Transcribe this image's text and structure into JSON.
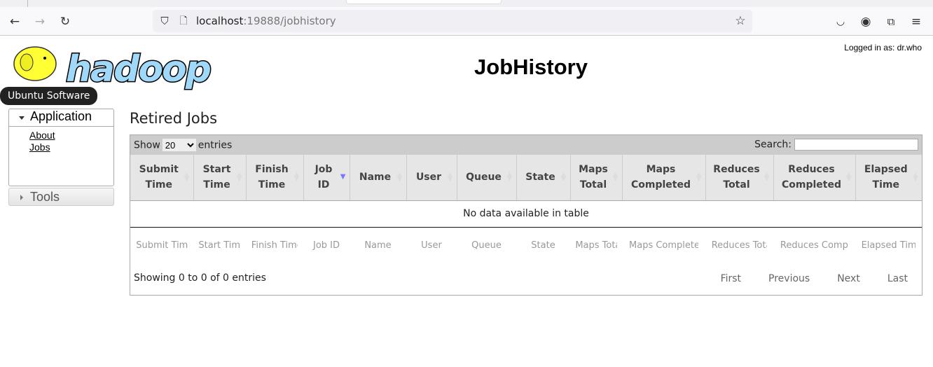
{
  "browser": {
    "url_host": "localhost",
    "url_rest": ":19888/jobhistory",
    "icons": [
      "back-icon",
      "forward-icon",
      "reload-icon",
      "shield-icon",
      "page-icon",
      "star-icon",
      "pocket-icon",
      "account-icon",
      "extensions-icon",
      "menu-icon"
    ]
  },
  "header": {
    "logo_text": "hadoop",
    "logged_in": "Logged in as: dr.who",
    "title": "JobHistory"
  },
  "tooltip": "Ubuntu Software",
  "sidebar": {
    "application": "Application",
    "links": [
      "About",
      "Jobs"
    ],
    "tools": "Tools"
  },
  "main": {
    "heading": "Retired Jobs",
    "show_label": "Show",
    "show_value": "20",
    "entries_label": "entries",
    "search_label": "Search:",
    "columns": [
      [
        "Submit",
        "Time"
      ],
      [
        "Start",
        "Time"
      ],
      [
        "Finish",
        "Time"
      ],
      [
        "Job",
        "ID"
      ],
      [
        "Name",
        ""
      ],
      [
        "User",
        ""
      ],
      [
        "Queue",
        ""
      ],
      [
        "State",
        ""
      ],
      [
        "Maps",
        "Total"
      ],
      [
        "Maps",
        "Completed"
      ],
      [
        "Reduces",
        "Total"
      ],
      [
        "Reduces",
        "Completed"
      ],
      [
        "Elapsed",
        "Time"
      ]
    ],
    "sorted_column": "Job ID",
    "empty_message": "No data available in table",
    "filter_placeholders": [
      "Submit Time",
      "Start Time",
      "Finish Time",
      "Job ID",
      "Name",
      "User",
      "Queue",
      "State",
      "Maps Total",
      "Maps Completed",
      "Reduces Total",
      "Reduces Completed",
      "Elapsed Time"
    ],
    "info": "Showing 0 to 0 of 0 entries",
    "pagination": [
      "First",
      "Previous",
      "Next",
      "Last"
    ]
  }
}
